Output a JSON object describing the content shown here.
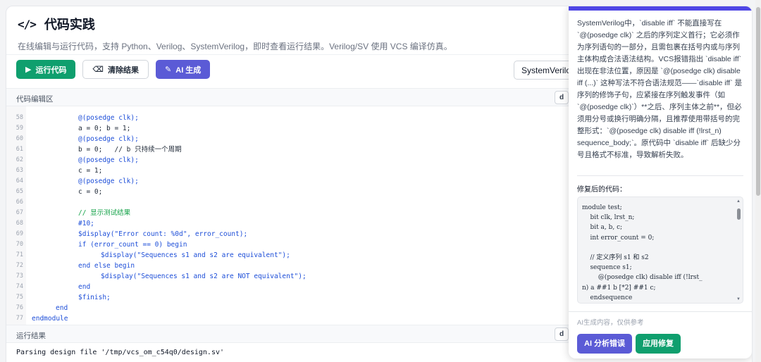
{
  "header": {
    "icon": "code-icon",
    "icon_glyph": "</>",
    "title": "代码实践",
    "subtitle": "在线编辑与运行代码，支持 Python、Verilog、SystemVerilog，即时查看运行结果。Verilog/SV 使用 VCS 编译仿真。"
  },
  "toolbar": {
    "run_label": "运行代码",
    "clear_label": "清除结果",
    "ai_label": "AI 生成",
    "language_value": "SystemVerilog"
  },
  "editor": {
    "label": "代码编辑区",
    "copy_label": "d",
    "lines": [
      {
        "n": "58",
        "text": "@(posedge clk);"
      },
      {
        "n": "59",
        "text": "a = 0; b = 1;"
      },
      {
        "n": "60",
        "text": "@(posedge clk);"
      },
      {
        "n": "61",
        "text": "b = 0;   // b 只持续一个周期"
      },
      {
        "n": "62",
        "text": "@(posedge clk);"
      },
      {
        "n": "63",
        "text": "c = 1;"
      },
      {
        "n": "64",
        "text": "@(posedge clk);"
      },
      {
        "n": "65",
        "text": "c = 0;"
      },
      {
        "n": "66",
        "text": ""
      },
      {
        "n": "67",
        "text": "// 显示测试结果"
      },
      {
        "n": "68",
        "text": "#10;"
      },
      {
        "n": "69",
        "text": "$display(\"Error count: %0d\", error_count);"
      },
      {
        "n": "70",
        "text": "if (error_count == 0) begin"
      },
      {
        "n": "71",
        "text": "$display(\"Sequences s1 and s2 are equivalent\");"
      },
      {
        "n": "72",
        "text": "end else begin"
      },
      {
        "n": "73",
        "text": "$display(\"Sequences s1 and s2 are NOT equivalent\");"
      },
      {
        "n": "74",
        "text": "end"
      },
      {
        "n": "75",
        "text": "$finish;"
      },
      {
        "n": "76",
        "text": "end"
      },
      {
        "n": "77",
        "text": "endmodule"
      }
    ]
  },
  "result": {
    "label": "运行结果",
    "copy_label": "d",
    "output": "Parsing design file '/tmp/vcs_om_c54q0/design.sv'"
  },
  "ai_panel": {
    "analysis": "SystemVerilog中，`disable iff` 不能直接写在 `@(posedge clk)` 之后的序列定义首行；它必须作为序列语句的一部分，且需包裹在括号内或与序列主体构成合法语法结构。VCS报错指出 `disable iff` 出现在非法位置，原因是 `@(posedge clk) disable iff (...)` 这种写法不符合语法规范——`disable iff` 是序列的修饰子句，应紧接在序列触发事件（如 `@(posedge clk)`）**之后、序列主体之前**，但必须用分号或换行明确分隔，且推荐使用带括号的完整形式：`@(posedge clk) disable iff (!lrst_n) sequence_body;`。原代码中 `disable iff` 后缺少分号且格式不标准，导致解析失败。",
    "fixed_label": "修复后的代码：",
    "fixed_code": "module test;\n    bit clk, lrst_n;\n    bit a, b, c;\n    int error_count = 0;\n\n    // 定义序列 s1 和 s2\n    sequence s1;\n        @(posedge clk) disable iff (!lrst_\nn) a ##1 b [*2] ##1 c;\n    endsequence",
    "disclaimer": "AI生成内容，仅供参考",
    "analyze_label": "AI 分析错误",
    "apply_label": "应用修复"
  }
}
